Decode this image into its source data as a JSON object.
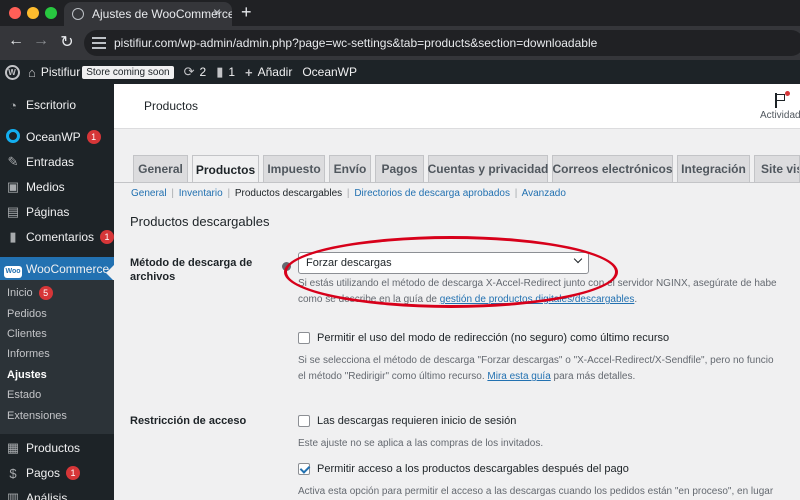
{
  "browser": {
    "tab_title": "Ajustes de WooCommerce ‹ Pi",
    "new_tab": "+",
    "close": "×",
    "url": "pistifiur.com/wp-admin/admin.php?page=wc-settings&tab=products&section=downloadable"
  },
  "adminbar": {
    "site_name": "Pistifiur",
    "store_badge": "Store coming soon",
    "updates_count": "2",
    "comments_count": "1",
    "add_new": "Añadir",
    "theme": "OceanWP"
  },
  "sidebar": {
    "items": [
      {
        "label": "Escritorio",
        "icon": "gauge-icon"
      },
      {
        "label": "OceanWP",
        "badge": "1",
        "icon": "oceanwp-icon"
      },
      {
        "label": "Entradas",
        "icon": "pin-icon"
      },
      {
        "label": "Medios",
        "icon": "media-icon"
      },
      {
        "label": "Páginas",
        "icon": "page-icon"
      },
      {
        "label": "Comentarios",
        "badge": "1",
        "icon": "comment-icon"
      },
      {
        "label": "WooCommerce",
        "icon": "woo-icon",
        "badge_text": "Woo"
      }
    ],
    "submenu": [
      {
        "label": "Inicio",
        "badge": "5"
      },
      {
        "label": "Pedidos"
      },
      {
        "label": "Clientes"
      },
      {
        "label": "Informes"
      },
      {
        "label": "Ajustes",
        "active": true
      },
      {
        "label": "Estado"
      },
      {
        "label": "Extensiones"
      }
    ],
    "bottom_items": [
      {
        "label": "Productos",
        "icon": "archive-icon"
      },
      {
        "label": "Pagos",
        "badge": "1",
        "icon": "dollar-icon"
      },
      {
        "label": "Análisis",
        "icon": "chart-icon"
      }
    ]
  },
  "header": {
    "title": "Productos",
    "activity": "Actividad"
  },
  "tabs": [
    {
      "label": "General"
    },
    {
      "label": "Productos",
      "active": true
    },
    {
      "label": "Impuesto"
    },
    {
      "label": "Envío"
    },
    {
      "label": "Pagos"
    },
    {
      "label": "Cuentas y privacidad"
    },
    {
      "label": "Correos electrónicos"
    },
    {
      "label": "Integración"
    },
    {
      "label": "Site visi"
    }
  ],
  "subnav": {
    "general": "General",
    "inventario": "Inventario",
    "downloadable": "Productos descargables",
    "approved_dirs": "Directorios de descarga aprobados",
    "advanced": "Avanzado",
    "sep": "|"
  },
  "section_title": "Productos descargables",
  "download_method": {
    "label_line1": "Método de descarga de",
    "label_line2": "archivos",
    "selected": "Forzar descargas",
    "desc_line1": "Si estás utilizando el método de descarga X-Accel-Redirect junto con el servidor NGINX, asegúrate de habe",
    "desc_line2_pre": "como se describe en la guía de ",
    "desc_line2_link": "gestión de productos digitales/descargables",
    "desc_line2_post": ".",
    "fallback_checkbox": "Permitir el uso del modo de redirección (no seguro) como último recurso",
    "fallback_checked": false,
    "fallback_desc_line1": "Si se selecciona el método de descarga \"Forzar descargas\" o \"X-Accel-Redirect/X-Sendfile\", pero no funcio",
    "fallback_desc_line2_pre": "el método \"Redirigir\" como último recurso. ",
    "fallback_desc_line2_link": "Mira esta guía",
    "fallback_desc_line2_post": " para más detalles."
  },
  "access_restriction": {
    "label": "Restricción de acceso",
    "login_checkbox": "Las descargas requieren inicio de sesión",
    "login_checked": false,
    "login_desc": "Este ajuste no se aplica a las compras de los invitados.",
    "after_payment_checkbox": "Permitir acceso a los productos descargables después del pago",
    "after_payment_checked": true,
    "after_payment_desc": "Activa esta opción para permitir el acceso a las descargas cuando los pedidos están \"en proceso\", en lugar"
  },
  "colors": {
    "admin_dark": "#1d2327",
    "accent_blue": "#2271b1",
    "badge_red": "#d63638",
    "annotation_red": "#d7001a"
  }
}
